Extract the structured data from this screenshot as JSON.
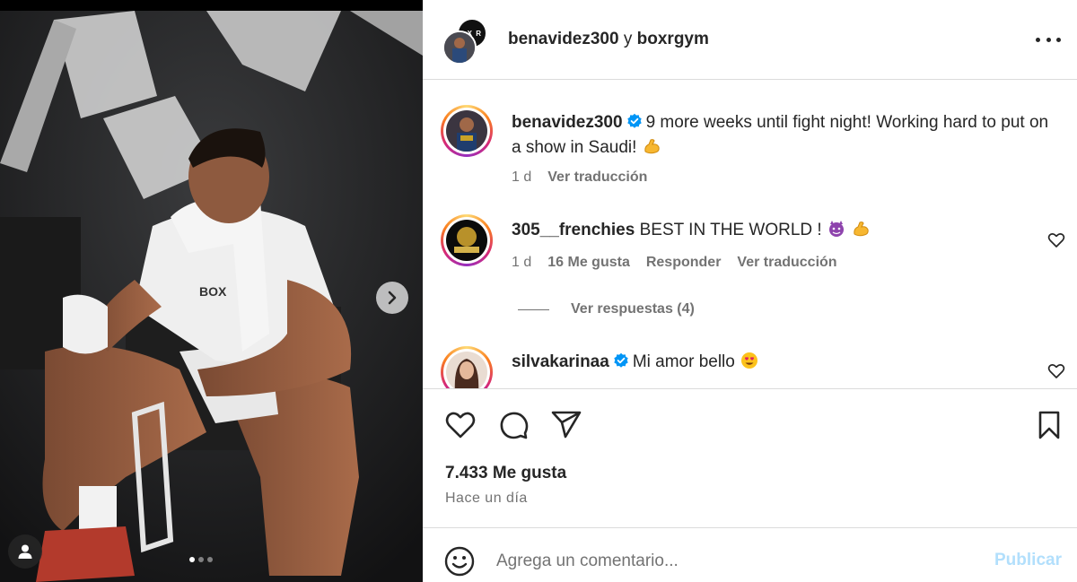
{
  "post": {
    "header": {
      "author": "benavidez300",
      "joiner": " y ",
      "coauthor": "boxrgym",
      "coauthor_avatar_text": "X R"
    },
    "caption": {
      "username": "benavidez300",
      "text": "9 more weeks until fight night! Working hard to put on a show in Saudi!",
      "emoji": "flexed-biceps",
      "time": "1 d",
      "translate": "Ver traducción"
    },
    "comments": [
      {
        "username": "305__frenchies",
        "text": "BEST IN THE WORLD !",
        "emojis": [
          "devil-face",
          "flexed-biceps"
        ],
        "time": "1 d",
        "likes": "16 Me gusta",
        "reply": "Responder",
        "translate": "Ver traducción",
        "view_replies": "Ver respuestas (4)"
      },
      {
        "username": "silvakarinaa",
        "text": "Mi amor bello",
        "emojis": [
          "heart-eyes-face"
        ]
      }
    ],
    "likes_count": "7.433 Me gusta",
    "posted_ago": "Hace un día",
    "add_comment": {
      "placeholder": "Agrega un comentario...",
      "publish": "Publicar"
    },
    "carousel": {
      "total": 3,
      "current": 1
    }
  },
  "photo": {
    "wall_lettering": "BOX",
    "shirt_text": "BOX"
  },
  "colors": {
    "verified": "#0095f6",
    "publish_disabled": "#b2dffc",
    "secondary_text": "#737373",
    "divider": "#dbdbdb"
  }
}
